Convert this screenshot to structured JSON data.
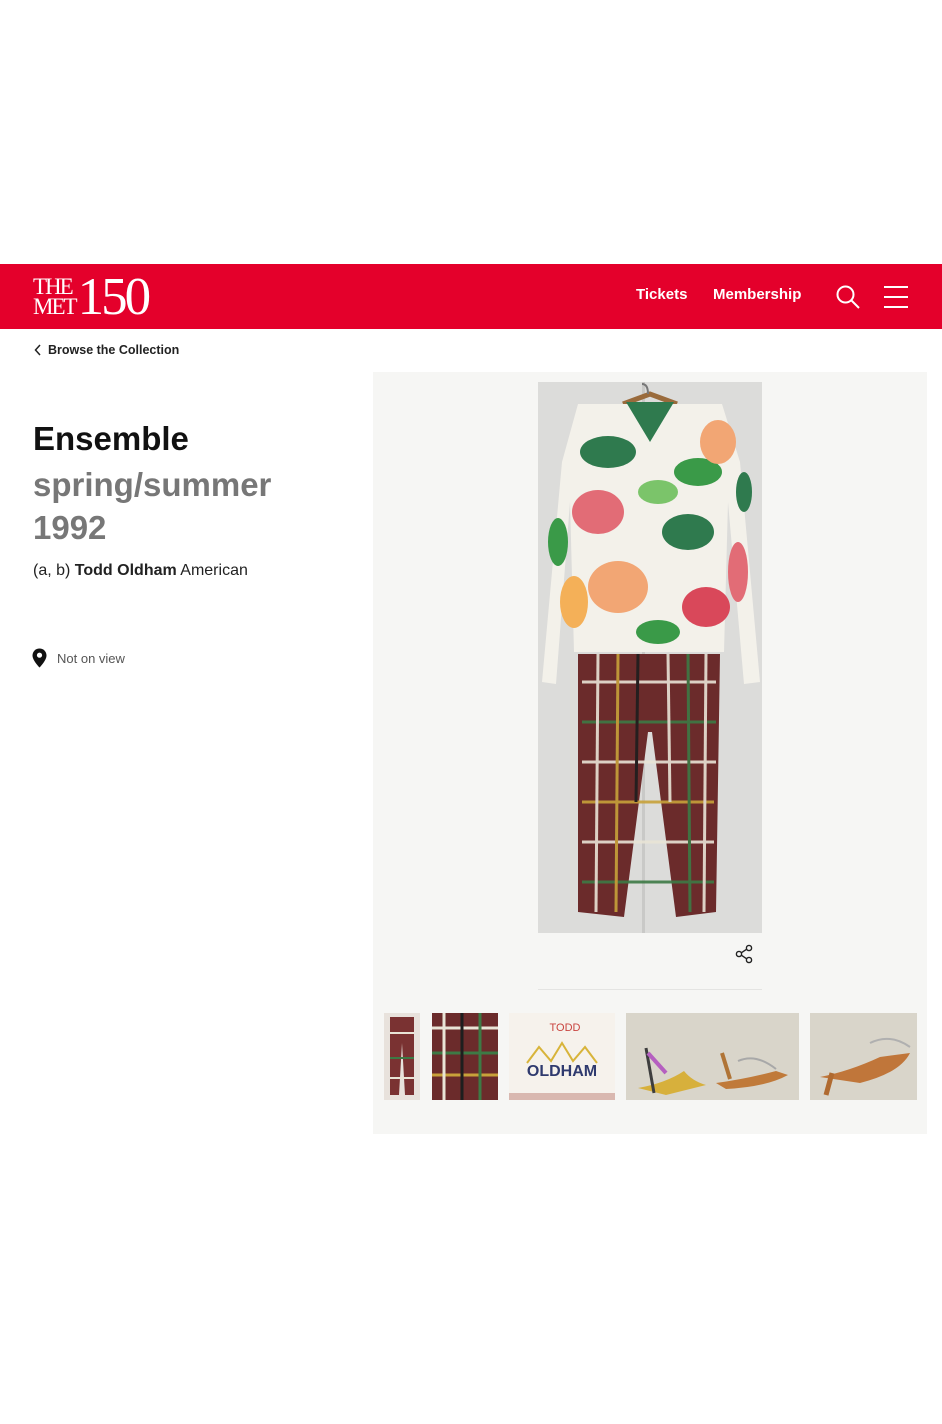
{
  "header": {
    "logo_line1": "THE",
    "logo_line2": "MET",
    "logo_number": "150",
    "nav": {
      "tickets": "Tickets",
      "membership": "Membership"
    },
    "brand_color": "#e4002b",
    "icons": [
      "search-icon",
      "menu-icon"
    ]
  },
  "breadcrumb": {
    "label": "Browse the Collection",
    "icon": "chevron-left-icon"
  },
  "object": {
    "title": "Ensemble",
    "date": "spring/summer 1992",
    "artist_prefix": "(a, b)",
    "artist_name": "Todd Oldham",
    "artist_nationality": "American",
    "location": "Not on view",
    "location_icon": "map-pin-icon"
  },
  "gallery": {
    "share_icon": "share-icon",
    "thumbnail_label_line1": "TODD",
    "thumbnail_label_line2": "OLDHAM"
  }
}
